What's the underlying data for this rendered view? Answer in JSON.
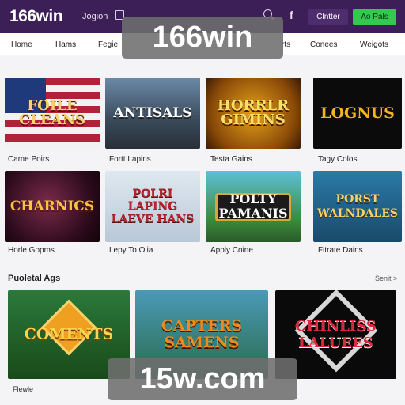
{
  "header": {
    "logo": "166win",
    "link": "Jogion",
    "login_label": "Clntter",
    "signup_label": "Ao Pals",
    "icons": [
      "account-icon",
      "search-icon",
      "facebook-icon"
    ]
  },
  "nav": {
    "items": [
      "Home",
      "Hams",
      "Fegie",
      "rts",
      "Conees",
      "Weigots"
    ]
  },
  "grid": [
    {
      "title": "FOILE CLEANS",
      "caption": "Came Poirs"
    },
    {
      "title": "ANTISALS",
      "caption": "Fortt Lapins"
    },
    {
      "title": "HORRLR GIMINS",
      "caption": "Testa Gains"
    },
    {
      "title": "LOGNUS",
      "caption": "Tagy Colos"
    },
    {
      "title": "CHARNICS",
      "caption": "Horle Gopms"
    },
    {
      "title": "POLRI LAPING LAEVE HANS",
      "caption": "Lepy To Olia"
    },
    {
      "title": "POLTY PAMANIS",
      "caption": "Apply Coine"
    },
    {
      "title": "PORST WALNDALES",
      "caption": "Fitrate Dains"
    }
  ],
  "featured": {
    "title": "Puoletal Ags",
    "see_all": "Senit >",
    "cards": [
      {
        "title": "COMENTS"
      },
      {
        "title": "CAPTERS SAMENS"
      },
      {
        "title": "CHINLISS LALUEES"
      }
    ],
    "bottom_caption": "Flewle"
  },
  "watermarks": [
    "166win",
    "15w.com"
  ]
}
